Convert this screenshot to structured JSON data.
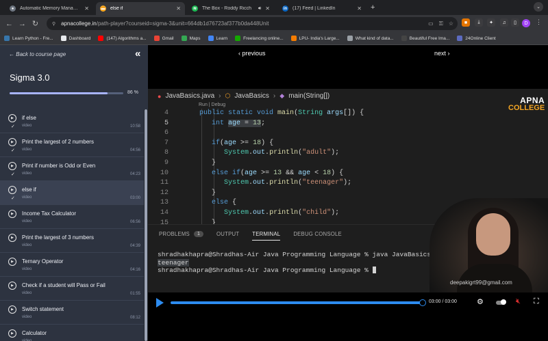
{
  "browser": {
    "tabs": [
      {
        "title": "Automatic Memory Managem",
        "icon": "github-icon",
        "color": "#6e7681",
        "glyph": "●"
      },
      {
        "title": "else if",
        "icon": "apnacollege-icon",
        "color": "#f5a623",
        "glyph": "▬"
      },
      {
        "title": "The Box - Roddy Ricch",
        "icon": "spotify-icon",
        "color": "#1db954",
        "glyph": "≋"
      },
      {
        "title": "(17) Feed | LinkedIn",
        "icon": "linkedin-icon",
        "color": "#0a66c2",
        "glyph": "in"
      }
    ],
    "active_tab": 1,
    "url_host": "apnacollege.in",
    "url_path": "/path-player?courseid=sigma-3&unit=664db1d76723af377b0da448Unit",
    "profile_initial": "D",
    "bookmarks": [
      {
        "label": "Learn Python - Fre...",
        "icon": "python-icon",
        "color": "#3776ab"
      },
      {
        "label": "Dashboard",
        "icon": "dashboard-icon",
        "color": "#e8eaed"
      },
      {
        "label": "(147) Algorithms a...",
        "icon": "youtube-icon",
        "color": "#ff0000"
      },
      {
        "label": "Gmail",
        "icon": "gmail-icon",
        "color": "#ea4335"
      },
      {
        "label": "Maps",
        "icon": "maps-icon",
        "color": "#34a853"
      },
      {
        "label": "Learn",
        "icon": "learn-icon",
        "color": "#4285f4"
      },
      {
        "label": "Freelancing online...",
        "icon": "freelancing-icon",
        "color": "#14a800"
      },
      {
        "label": "LPU- India's Large...",
        "icon": "lpu-icon",
        "color": "#f57c00"
      },
      {
        "label": "What kind of data...",
        "icon": "quora-icon",
        "color": "#9aa0a6"
      },
      {
        "label": "Beautiful Free Ima...",
        "icon": "unsplash-icon",
        "color": "#444444"
      },
      {
        "label": "24Online Client",
        "icon": "online-client-icon",
        "color": "#5c6bc0"
      }
    ]
  },
  "sidebar": {
    "back_label": "Back to course page",
    "course_title": "Sigma 3.0",
    "progress_percent": 86,
    "progress_label": "86 %",
    "lessons": [
      {
        "title": "if else",
        "type": "video",
        "duration": "10:58",
        "done": true,
        "active": false
      },
      {
        "title": "Print the largest of 2 numbers",
        "type": "video",
        "duration": "04:56",
        "done": true,
        "active": false
      },
      {
        "title": "Print if number is Odd or Even",
        "type": "video",
        "duration": "04:23",
        "done": true,
        "active": false
      },
      {
        "title": "else if",
        "type": "video",
        "duration": "03:00",
        "done": true,
        "active": true
      },
      {
        "title": "Income Tax Calculator",
        "type": "video",
        "duration": "06:56",
        "done": false,
        "active": false
      },
      {
        "title": "Print the largest of 3 numbers",
        "type": "video",
        "duration": "04:39",
        "done": false,
        "active": false
      },
      {
        "title": "Ternary Operator",
        "type": "video",
        "duration": "04:16",
        "done": false,
        "active": false
      },
      {
        "title": "Check if a student will Pass or Fail",
        "type": "video",
        "duration": "01:55",
        "done": false,
        "active": false
      },
      {
        "title": "Switch statement",
        "type": "video",
        "duration": "08:12",
        "done": false,
        "active": false
      },
      {
        "title": "Calculator",
        "type": "video",
        "duration": "",
        "done": false,
        "active": false
      }
    ]
  },
  "player": {
    "prev_label": "‹ previous",
    "next_label": "next ›",
    "time_label": "03:00 / 03:00",
    "progress_fraction": 1.0,
    "watermark": "deepakigrt99@gmail.com"
  },
  "editor": {
    "file": "JavaBasics.java",
    "class": "JavaBasics",
    "method": "main(String[])",
    "codelens": "Run | Debug",
    "logo_line1": "APNA",
    "logo_line2": "COLLEGE",
    "current_line": 5,
    "lines": [
      {
        "n": 4,
        "indent": 1,
        "tokens": [
          [
            "kw",
            "public "
          ],
          [
            "kw",
            "static "
          ],
          [
            "kw",
            "void "
          ],
          [
            "fn",
            "main"
          ],
          [
            "op",
            "("
          ],
          [
            "ty",
            "String "
          ],
          [
            "vr",
            "args"
          ],
          [
            "op",
            "[]) {"
          ]
        ]
      },
      {
        "n": 5,
        "indent": 2,
        "tokens": [
          [
            "kw",
            "int "
          ],
          [
            "vr",
            "age"
          ],
          [
            "op",
            " = "
          ],
          [
            "nm",
            "13"
          ],
          [
            "op",
            ";"
          ]
        ]
      },
      {
        "n": 6,
        "indent": 0,
        "tokens": []
      },
      {
        "n": 7,
        "indent": 2,
        "tokens": [
          [
            "kw",
            "if"
          ],
          [
            "op",
            "("
          ],
          [
            "vr",
            "age"
          ],
          [
            "op",
            " >= "
          ],
          [
            "nm",
            "18"
          ],
          [
            "op",
            ") {"
          ]
        ]
      },
      {
        "n": 8,
        "indent": 3,
        "tokens": [
          [
            "ty",
            "System"
          ],
          [
            "op",
            "."
          ],
          [
            "vr",
            "out"
          ],
          [
            "op",
            "."
          ],
          [
            "fn",
            "println"
          ],
          [
            "op",
            "("
          ],
          [
            "st",
            "\"adult\""
          ],
          [
            "op",
            ");"
          ]
        ]
      },
      {
        "n": 9,
        "indent": 2,
        "tokens": [
          [
            "op",
            "}"
          ]
        ]
      },
      {
        "n": 10,
        "indent": 2,
        "tokens": [
          [
            "kw",
            "else "
          ],
          [
            "kw",
            "if"
          ],
          [
            "op",
            "("
          ],
          [
            "vr",
            "age"
          ],
          [
            "op",
            " >= "
          ],
          [
            "nm",
            "13"
          ],
          [
            "op",
            " && "
          ],
          [
            "vr",
            "age"
          ],
          [
            "op",
            " < "
          ],
          [
            "nm",
            "18"
          ],
          [
            "op",
            ") {"
          ]
        ]
      },
      {
        "n": 11,
        "indent": 3,
        "tokens": [
          [
            "ty",
            "System"
          ],
          [
            "op",
            "."
          ],
          [
            "vr",
            "out"
          ],
          [
            "op",
            "."
          ],
          [
            "fn",
            "println"
          ],
          [
            "op",
            "("
          ],
          [
            "st",
            "\"teenager\""
          ],
          [
            "op",
            ");"
          ]
        ]
      },
      {
        "n": 12,
        "indent": 2,
        "tokens": [
          [
            "op",
            "}"
          ]
        ]
      },
      {
        "n": 13,
        "indent": 2,
        "tokens": [
          [
            "kw",
            "else "
          ],
          [
            "op",
            "{"
          ]
        ]
      },
      {
        "n": 14,
        "indent": 3,
        "tokens": [
          [
            "ty",
            "System"
          ],
          [
            "op",
            "."
          ],
          [
            "vr",
            "out"
          ],
          [
            "op",
            "."
          ],
          [
            "fn",
            "println"
          ],
          [
            "op",
            "("
          ],
          [
            "st",
            "\"child\""
          ],
          [
            "op",
            ");"
          ]
        ]
      },
      {
        "n": 15,
        "indent": 2,
        "tokens": [
          [
            "op",
            "}"
          ]
        ]
      }
    ]
  },
  "panel": {
    "tabs": [
      {
        "label": "PROBLEMS",
        "badge": "1",
        "active": false
      },
      {
        "label": "OUTPUT",
        "badge": "",
        "active": false
      },
      {
        "label": "TERMINAL",
        "badge": "",
        "active": true
      },
      {
        "label": "DEBUG CONSOLE",
        "badge": "",
        "active": false
      }
    ],
    "terminal": [
      "shradhakhapra@Shradhas-Air Java Programming Language % java JavaBasics",
      "teenager",
      "shradhakhapra@Shradhas-Air Java Programming Language % "
    ]
  }
}
